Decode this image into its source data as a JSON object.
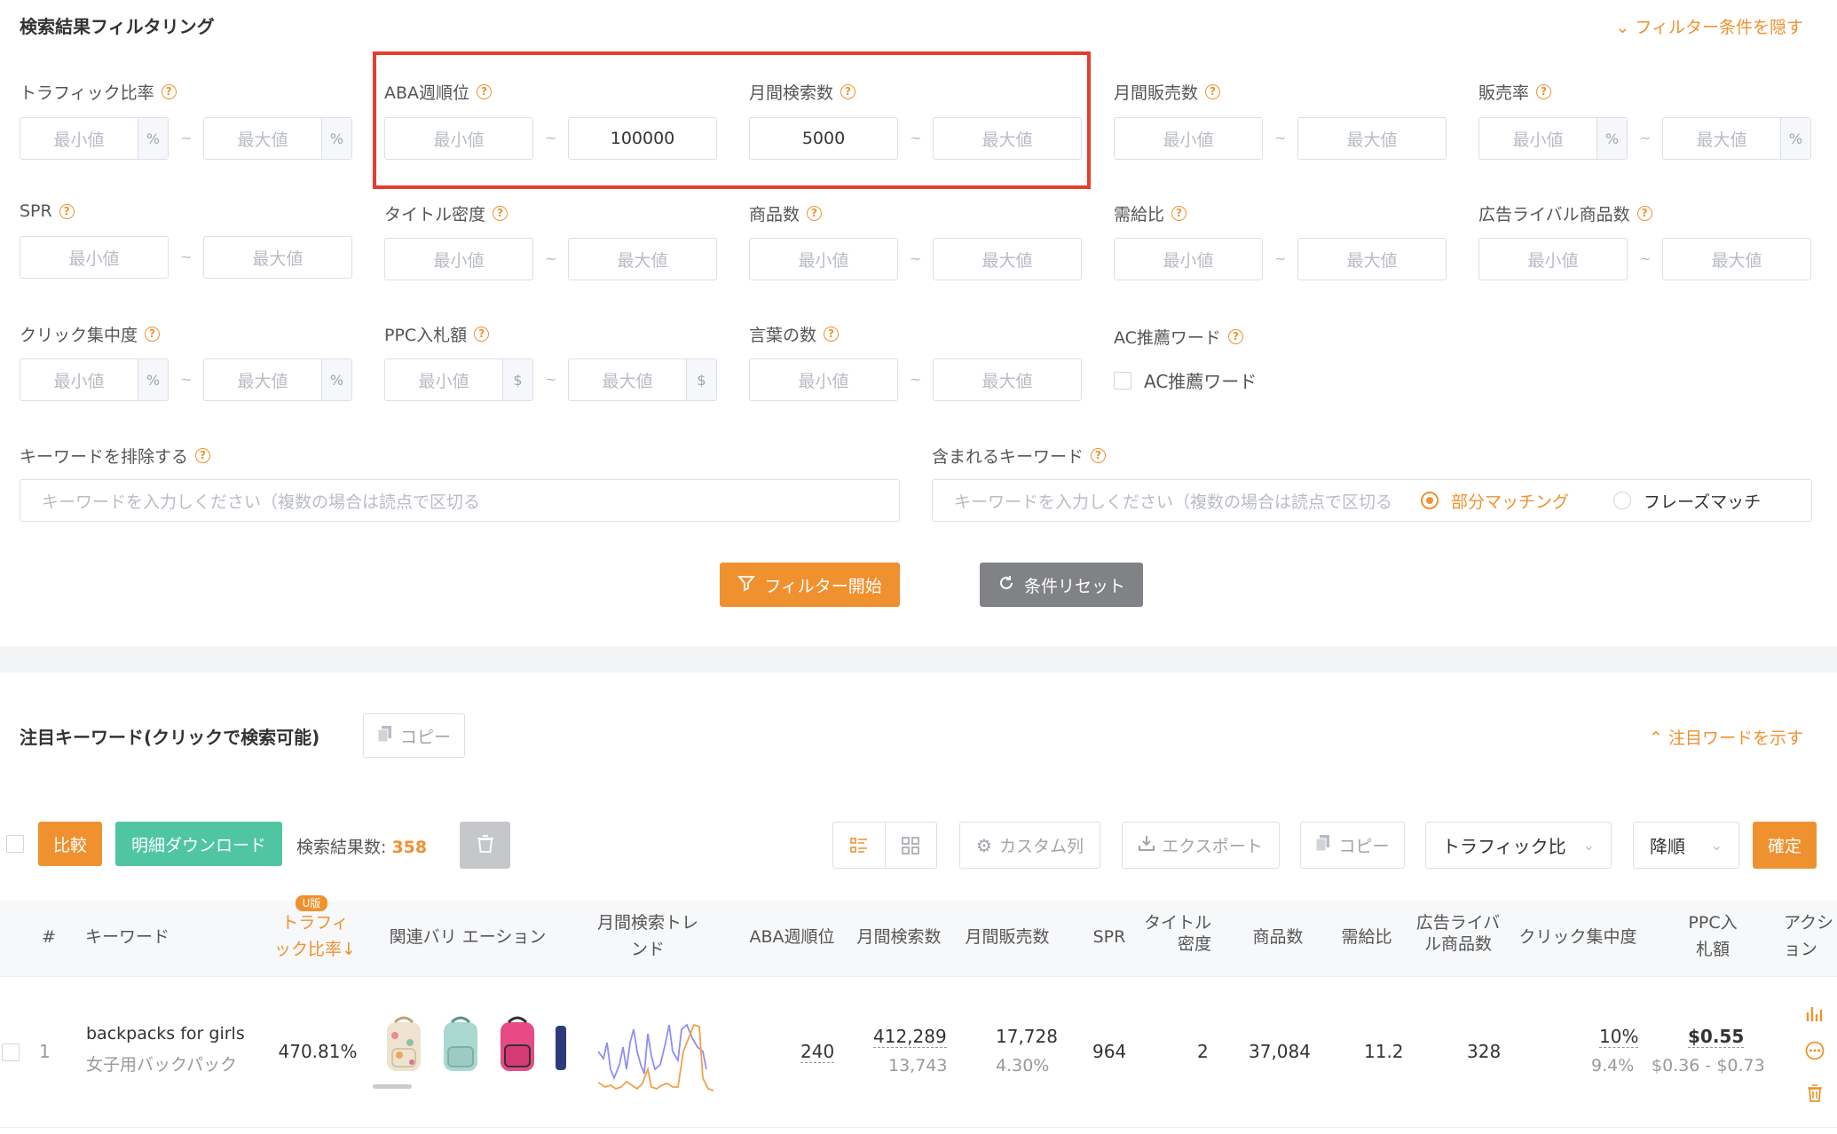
{
  "filter": {
    "title": "検索結果フィルタリング",
    "hide_link": "フィルター条件を隠す",
    "min_ph": "最小値",
    "max_ph": "最大値",
    "tilde": "~",
    "fields": {
      "traffic_ratio": {
        "label": "トラフィック比率",
        "unit": "%"
      },
      "aba_rank": {
        "label": "ABA週順位",
        "min": "",
        "max": "100000"
      },
      "monthly_search": {
        "label": "月間検索数",
        "min": "5000",
        "max": ""
      },
      "monthly_sales": {
        "label": "月間販売数"
      },
      "sales_rate": {
        "label": "販売率",
        "unit": "%"
      },
      "spr": {
        "label": "SPR"
      },
      "title_density": {
        "label": "タイトル密度"
      },
      "product_count": {
        "label": "商品数"
      },
      "supply_demand": {
        "label": "需給比"
      },
      "ad_rivals": {
        "label": "広告ライバル商品数"
      },
      "click_concentration": {
        "label": "クリック集中度",
        "unit": "%"
      },
      "ppc_bid": {
        "label": "PPC入札額",
        "unit": "$"
      },
      "word_count": {
        "label": "言葉の数"
      },
      "ac_words": {
        "label": "AC推薦ワード",
        "checkbox_label": "AC推薦ワード"
      }
    },
    "exclude_keywords": {
      "label": "キーワードを排除する",
      "placeholder": "キーワードを入力しください（複数の場合は読点で区切る"
    },
    "include_keywords": {
      "label": "含まれるキーワード",
      "placeholder": "キーワードを入力しください（複数の場合は読点で区切る",
      "option_partial": "部分マッチング",
      "option_phrase": "フレーズマッチ",
      "selected": "部分マッチング"
    },
    "start_button": "フィルター開始",
    "reset_button": "条件リセット",
    "help_glyph": "?"
  },
  "focus": {
    "title": "注目キーワード(クリックで検索可能)",
    "copy_button": "コピー",
    "show_link": "注目ワードを示す"
  },
  "toolbar": {
    "compare": "比較",
    "download": "明細ダウンロード",
    "result_label": "検索結果数:",
    "result_count": "358",
    "custom_columns": "カスタム列",
    "export": "エクスポート",
    "copy": "コピー",
    "sort_field": "トラフィック比",
    "sort_order": "降順",
    "confirm": "確定"
  },
  "table": {
    "headers": {
      "num": "#",
      "keyword": "キーワード",
      "traffic_line1": "トラフィ",
      "traffic_line2": "ック比率↓",
      "traffic_badge": "U版",
      "variations": "関連バリ エーション",
      "trend_line1": "月間検索トレ",
      "trend_line2": "ンド",
      "aba": "ABA週順位",
      "monthly_search": "月間検索数",
      "monthly_sales": "月間販売数",
      "spr": "SPR",
      "title_density_line1": "タイトル",
      "title_density_line2": "密度",
      "product_count": "商品数",
      "supply_demand": "需給比",
      "ad_rivals_line1": "広告ライバ",
      "ad_rivals_line2": "ル商品数",
      "click_concentration": "クリック集中度",
      "ppc_line1": "PPC入",
      "ppc_line2": "札額",
      "action_line1": "アクシ",
      "action_line2": "ョン"
    },
    "rows": [
      {
        "num": "1",
        "keyword": "backpacks for girls",
        "keyword_ja": "女子用バックパック",
        "traffic_ratio": "470.81%",
        "aba_rank": "240",
        "monthly_search": "412,289",
        "monthly_search_sub": "13,743",
        "monthly_sales": "17,728",
        "monthly_sales_sub": "4.30%",
        "spr": "964",
        "title_density": "2",
        "product_count": "37,084",
        "supply_demand": "11.2",
        "ad_rivals": "328",
        "click_concentration": "10%",
        "click_concentration_sub": "9.4%",
        "ppc_bid": "$0.55",
        "ppc_range": "$0.36 - $0.73"
      }
    ]
  },
  "colors": {
    "accent": "#f0912f",
    "highlight_box": "#e53e2e",
    "green": "#4fc6a1",
    "trend_blue": "#8f8ff0",
    "trend_orange": "#f0a04a"
  }
}
